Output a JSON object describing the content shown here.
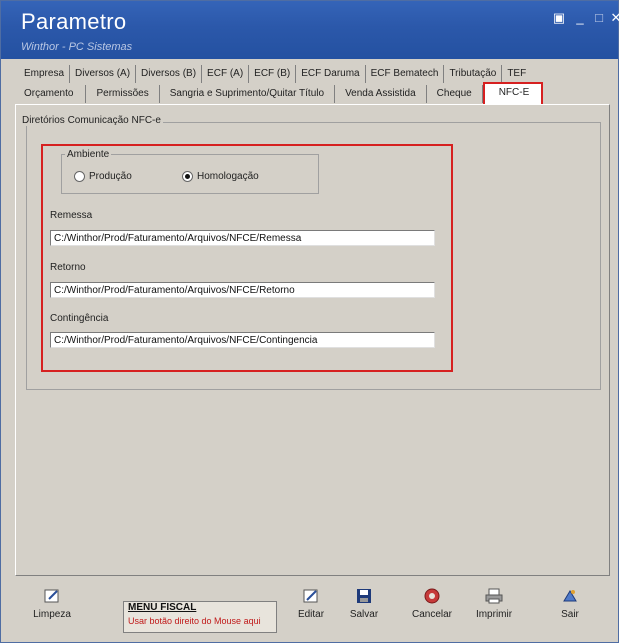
{
  "window": {
    "title": "Parametro",
    "subtitle": "Winthor - PC Sistemas"
  },
  "tabs_row1": [
    "Empresa",
    "Diversos (A)",
    "Diversos (B)",
    "ECF (A)",
    "ECF (B)",
    "ECF Daruma",
    "ECF Bematech",
    "Tributação",
    "TEF"
  ],
  "tabs_row2": [
    "Orçamento",
    "Permissões",
    "Sangria e Suprimento/Quitar Título",
    "Venda Assistida",
    "Cheque",
    "NFC-E"
  ],
  "active_tab": "NFC-E",
  "group": {
    "title": "Diretórios Comunicação NFC-e",
    "ambiente": {
      "label": "Ambiente",
      "options": [
        "Produção",
        "Homologação"
      ],
      "selected": "Homologação"
    },
    "fields": [
      {
        "label": "Remessa",
        "value": "C:/Winthor/Prod/Faturamento/Arquivos/NFCE/Remessa"
      },
      {
        "label": "Retorno",
        "value": "C:/Winthor/Prod/Faturamento/Arquivos/NFCE/Retorno"
      },
      {
        "label": "Contingência",
        "value": "C:/Winthor/Prod/Faturamento/Arquivos/NFCE/Contingencia"
      }
    ]
  },
  "bottom": {
    "limpeza": "Limpeza",
    "menu_fiscal_title": "MENU FISCAL",
    "menu_fiscal_hint": "Usar botão direito do Mouse aqui",
    "editar": "Editar",
    "salvar": "Salvar",
    "cancelar": "Cancelar",
    "imprimir": "Imprimir",
    "sair": "Sair"
  },
  "colors": {
    "titlebar": "#2b58aa",
    "highlight": "#d62020",
    "window_bg": "#d4d0c8"
  }
}
